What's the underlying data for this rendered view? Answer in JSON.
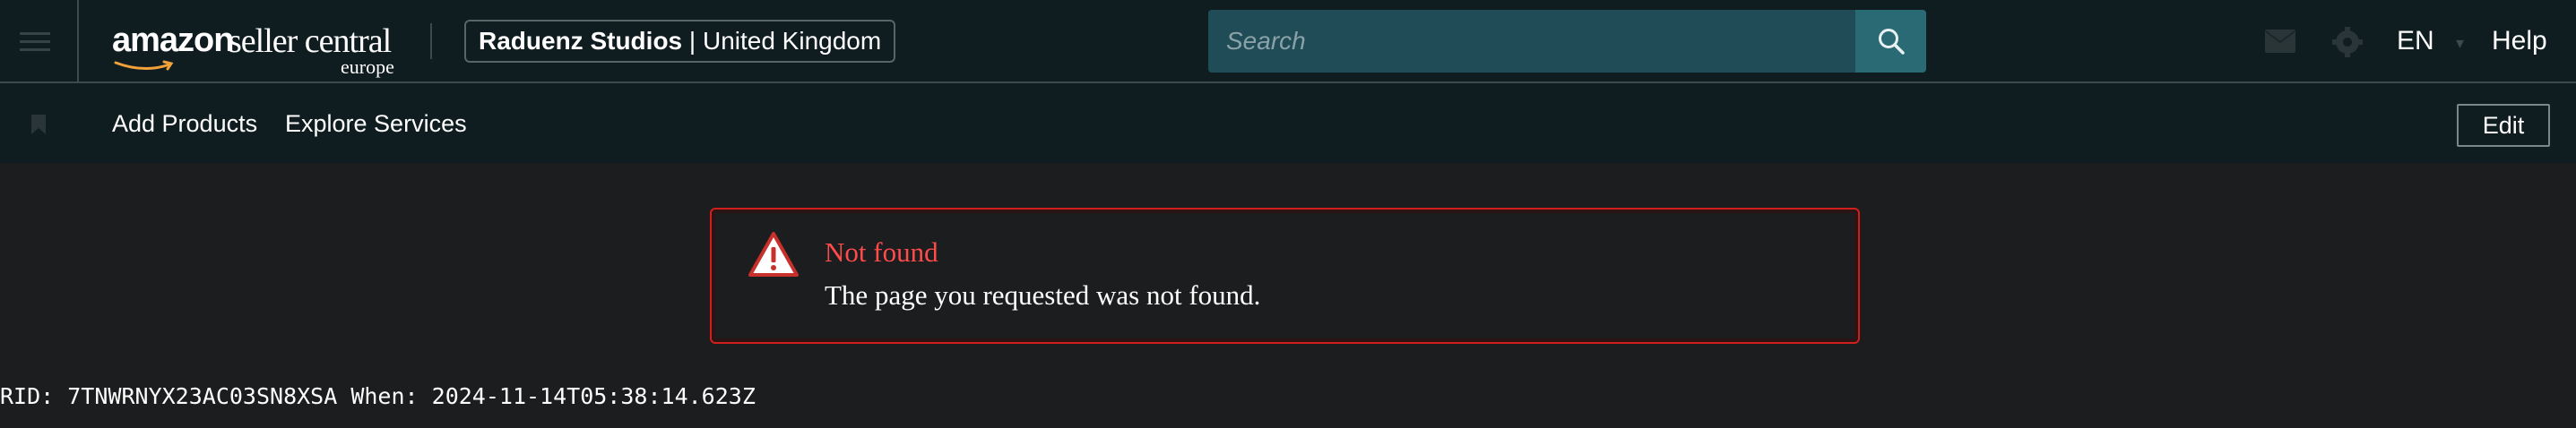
{
  "header": {
    "logo": {
      "brand": "amazon",
      "product": "seller central",
      "region": "europe"
    },
    "account": {
      "name": "Raduenz Studios",
      "separator": "|",
      "marketplace": "United Kingdom"
    },
    "search": {
      "placeholder": "Search"
    },
    "language": "EN",
    "help_label": "Help"
  },
  "navbar": {
    "links": [
      "Add Products",
      "Explore Services"
    ],
    "edit_label": "Edit"
  },
  "error": {
    "title": "Not found",
    "message": "The page you requested was not found."
  },
  "footer_rid": "RID: 7TNWRNYX23AC03SN8XSA When: 2024-11-14T05:38:14.623Z",
  "colors": {
    "header_bg": "#0f1c20",
    "page_bg": "#1b1d1e",
    "search_bg": "#1f4c56",
    "search_button": "#2a6a75",
    "error_border": "#d31e1e",
    "error_title": "#ff4b4b"
  }
}
